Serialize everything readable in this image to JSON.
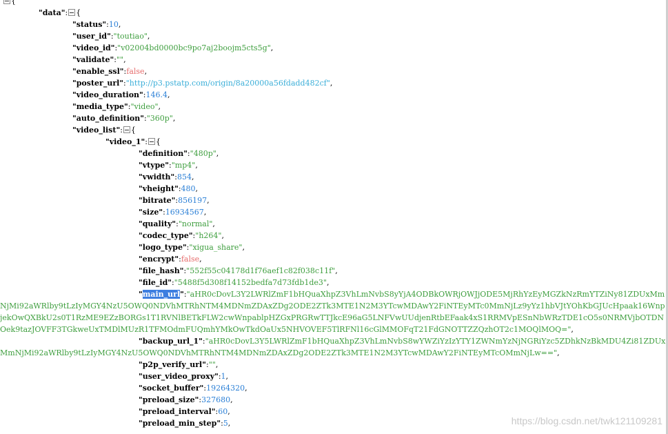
{
  "viewer": {
    "toggle_symbol": "⊟",
    "open_brace": "{"
  },
  "entries": {
    "data": {
      "key": "\"data\"",
      "sep": ":"
    },
    "status": {
      "key": "\"status\"",
      "value": "10"
    },
    "user_id": {
      "key": "\"user_id\"",
      "value": "\"toutiao\""
    },
    "video_id": {
      "key": "\"video_id\"",
      "value": "\"v02004bd0000bc9po7aj2boojm5cts5g\""
    },
    "validate": {
      "key": "\"validate\"",
      "value": "\"\""
    },
    "enable_ssl": {
      "key": "\"enable_ssl\"",
      "value": "false"
    },
    "poster_url": {
      "key": "\"poster_url\"",
      "value": "\"http://p3.pstatp.com/origin/8a20000a56fdadd482cf\""
    },
    "video_duration": {
      "key": "\"video_duration\"",
      "value": "146.4"
    },
    "media_type": {
      "key": "\"media_type\"",
      "value": "\"video\""
    },
    "auto_definition": {
      "key": "\"auto_definition\"",
      "value": "\"360p\""
    },
    "video_list": {
      "key": "\"video_list\""
    },
    "video_1": {
      "key": "\"video_1\""
    },
    "definition": {
      "key": "\"definition\"",
      "value": "\"480p\""
    },
    "vtype": {
      "key": "\"vtype\"",
      "value": "\"mp4\""
    },
    "vwidth": {
      "key": "\"vwidth\"",
      "value": "854"
    },
    "vheight": {
      "key": "\"vheight\"",
      "value": "480"
    },
    "bitrate": {
      "key": "\"bitrate\"",
      "value": "856197"
    },
    "size": {
      "key": "\"size\"",
      "value": "16934567"
    },
    "quality": {
      "key": "\"quality\"",
      "value": "\"normal\""
    },
    "codec_type": {
      "key": "\"codec_type\"",
      "value": "\"h264\""
    },
    "logo_type": {
      "key": "\"logo_type\"",
      "value": "\"xigua_share\""
    },
    "encrypt": {
      "key": "\"encrypt\"",
      "value": "false"
    },
    "file_hash": {
      "key": "\"file_hash\"",
      "value": "\"552f55c04178d1f76aef1c82f038c11f\""
    },
    "file_id": {
      "key": "\"file_id\"",
      "value": "\"5488f5d308f14152bedfa7d73fdb1de3\""
    },
    "main_url": {
      "quote_open": "\"",
      "key_text": "main_url",
      "quote_close": "\"",
      "value": "\"aHR0cDovL3Y2LWRlZmF1bHQuaXhpZ3VhLmNvbS8yYjA4ODBkOWRjOWJjODE5MjRhYzEyMGZkNzRmYTZiNy81ZDUxMmNjMi92aWRlby9tLzIyMGY4NzU5OWQ0NDVhMTRhNTM4MDNmZDAxZDg2ODE2ZTk3MTE1N2M3YTcwMDAwY2FiNTEyMTc0MmNjLz9yYz1hbVJtYOhKbGJUcHpaak16WnpjekOwQXBkU2s0T1RzME9EZzBORGs1T1RVNlBETkFLW2cwWnpablpHZGxPRGRwTTJkcE96aG5LNFVwUUdjenRtbEFaak4xS1RRMVpESnNbWRzTDE1cO5s0NRMVjbOTDNOek9tazJOVFF3TGkweUxTMDlMUzR1TFMOdmFUQmhYMkOwTkdOaUx5NHVOVEF5TlRFNl16cGlMMOFqT21FdGNOTTZZQzhOT2c1MOQlMOQ=\""
    },
    "backup_url_1": {
      "key": "\"backup_url_1\"",
      "value": "\"aHR0cDovL3Y5LWRlZmF1bHQuaXhpZ3VhLmNvbS8wYWZiYzIzYTY1ZWNmYzNjNGRiYzc5ZDhkNzBkMDU4Zi81ZDUxMmNjMi92aWRlby9tLzIyMGY4NzU5OWQ0NDVhMTRhNTM4MDNmZDAxZDg2ODE2ZTk3MTE1N2M3YTcwMDAwY2FiNTEyMTcOMmNjLw==\""
    },
    "p2p_verify_url": {
      "key": "\"p2p_verify_url\"",
      "value": "\"\""
    },
    "user_video_proxy": {
      "key": "\"user_video_proxy\"",
      "value": "1"
    },
    "socket_buffer": {
      "key": "\"socket_buffer\"",
      "value": "19264320"
    },
    "preload_size": {
      "key": "\"preload_size\"",
      "value": "327680"
    },
    "preload_interval": {
      "key": "\"preload_interval\"",
      "value": "60"
    },
    "preload_min_step": {
      "key": "\"preload_min_step\"",
      "value": "5"
    }
  },
  "watermark": "https://blog.csdn.net/twk121109281",
  "colors": {
    "key": "#000000",
    "string": "#3e9e3e",
    "number": "#2a7fd6",
    "boolean": "#e66b6b",
    "url": "#3aaed8",
    "highlight": "#3d7ee0"
  }
}
